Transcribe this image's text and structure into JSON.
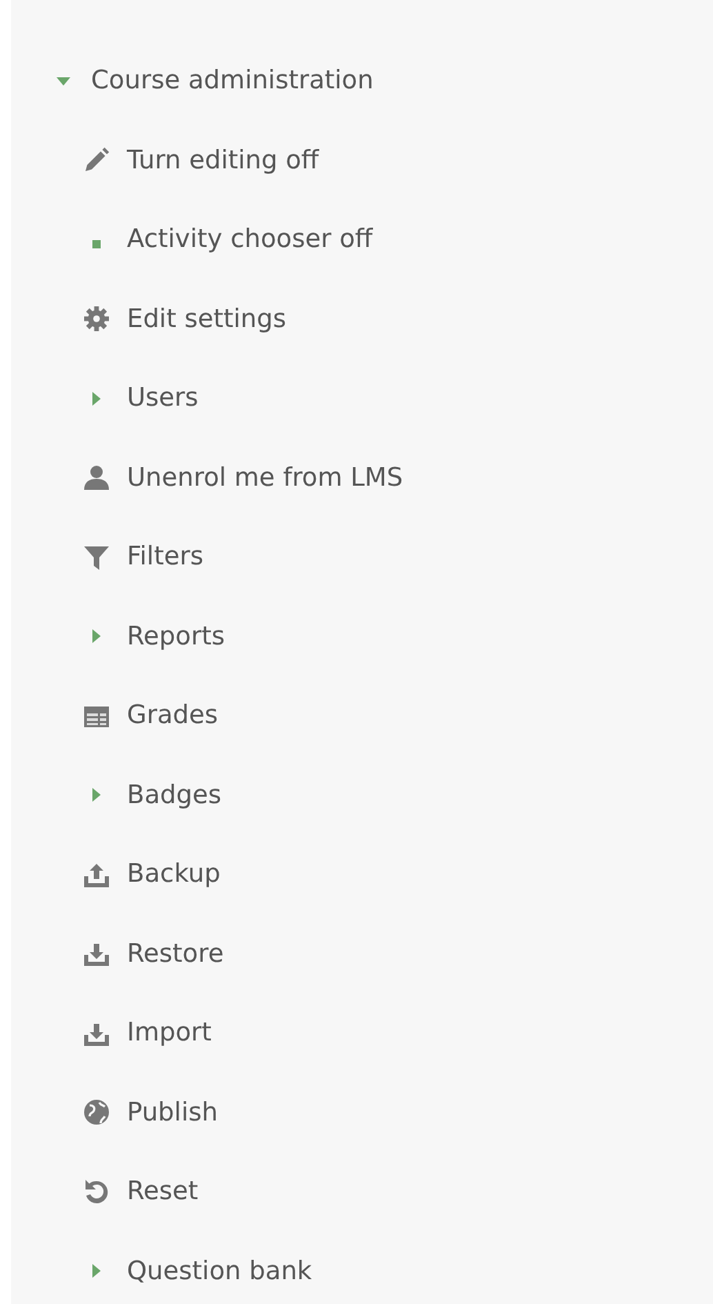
{
  "block": {
    "title": "Course administration",
    "expanded": true,
    "items": [
      {
        "label": "Turn editing off",
        "kind": "link"
      },
      {
        "label": "Activity chooser off",
        "kind": "link"
      },
      {
        "label": "Edit settings",
        "kind": "link"
      },
      {
        "label": "Users",
        "kind": "branch",
        "expanded": false
      },
      {
        "label": "Unenrol me from LMS",
        "kind": "link"
      },
      {
        "label": "Filters",
        "kind": "link"
      },
      {
        "label": "Reports",
        "kind": "branch",
        "expanded": false
      },
      {
        "label": "Grades",
        "kind": "link"
      },
      {
        "label": "Badges",
        "kind": "branch",
        "expanded": false
      },
      {
        "label": "Backup",
        "kind": "link"
      },
      {
        "label": "Restore",
        "kind": "link"
      },
      {
        "label": "Import",
        "kind": "link"
      },
      {
        "label": "Publish",
        "kind": "link"
      },
      {
        "label": "Reset",
        "kind": "link"
      },
      {
        "label": "Question bank",
        "kind": "branch",
        "expanded": false
      }
    ]
  }
}
